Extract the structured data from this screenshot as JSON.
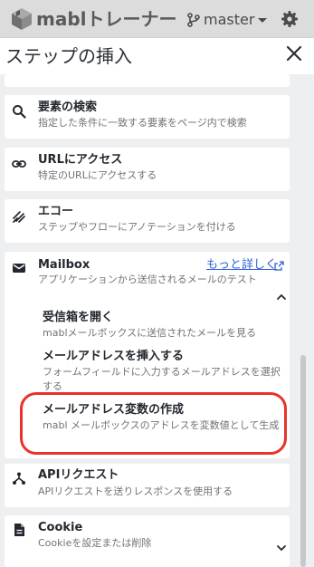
{
  "app": {
    "title": "mablトレーナー",
    "branch": "master"
  },
  "dialog": {
    "title": "ステップの挿入"
  },
  "items": [
    {
      "title": "要素の検索",
      "desc": "指定した条件に一致する要素をページ内で検索",
      "icon": "search-icon"
    },
    {
      "title": "URLにアクセス",
      "desc": "特定のURLにアクセスする",
      "icon": "link-icon"
    },
    {
      "title": "エコー",
      "desc": "ステップやフローにアノテーションを付ける",
      "icon": "echo-icon"
    },
    {
      "title": "Mailbox",
      "desc": "アプリケーションから送信されるメールのテスト",
      "icon": "mail-icon",
      "link": "もっと詳しく"
    },
    {
      "title": "APIリクエスト",
      "desc": "APIリクエストを送りレスポンスを使用する",
      "icon": "api-icon"
    },
    {
      "title": "Cookie",
      "desc": "Cookieを設定または削除",
      "icon": "document-icon"
    }
  ],
  "mailbox_sub": [
    {
      "title": "受信箱を開く",
      "desc": "mablメールボックスに送信されたメールを見る"
    },
    {
      "title": "メールアドレスを挿入する",
      "desc": "フォームフィールドに入力するメールアドレスを選択する"
    },
    {
      "title": "メールアドレス変数の作成",
      "desc": "mabl メールボックスのアドレスを変数値として生成"
    }
  ],
  "colors": {
    "accent": "#2f62d9",
    "highlight": "#e8322a",
    "topbar": "#dcdcdc",
    "panel": "#eeeff1"
  }
}
